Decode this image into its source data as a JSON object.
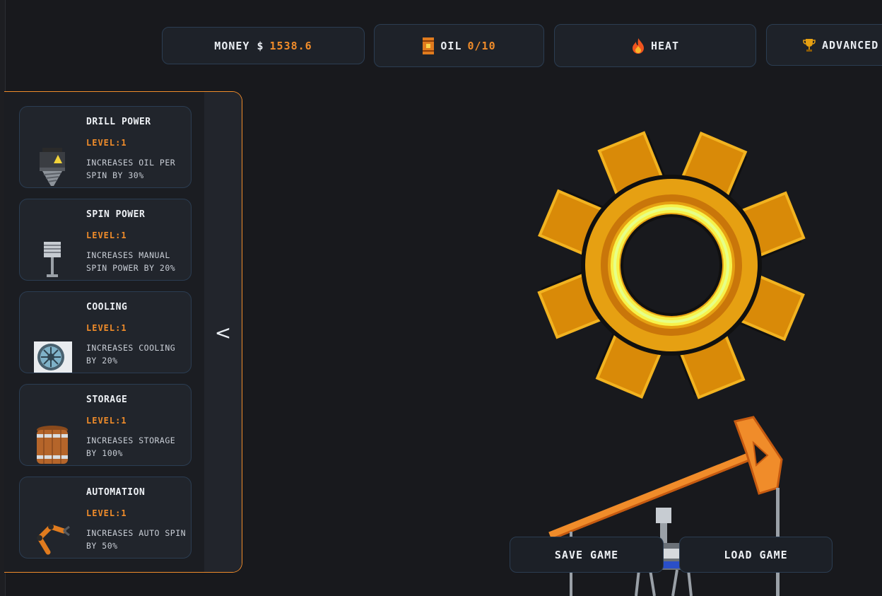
{
  "stats": {
    "money_label": "MONEY $",
    "money_value": "1538.6",
    "oil_label": "OIL",
    "oil_value": "0/10",
    "heat_label": "HEAT",
    "advanced_label": "ADVANCED"
  },
  "upgrades": [
    {
      "name": "DRILL POWER",
      "level": "LEVEL:1",
      "description": "INCREASES OIL PER SPIN BY 30%",
      "icon": "drill-icon"
    },
    {
      "name": "SPIN POWER",
      "level": "LEVEL:1",
      "description": "INCREASES MANUAL SPIN POWER BY 20%",
      "icon": "piston-icon"
    },
    {
      "name": "COOLING",
      "level": "LEVEL:1",
      "description": "INCREASES COOLING BY 20%",
      "icon": "fan-icon"
    },
    {
      "name": "STORAGE",
      "level": "LEVEL:1",
      "description": "INCREASES STORAGE BY 100%",
      "icon": "barrel-icon"
    },
    {
      "name": "AUTOMATION",
      "level": "LEVEL:1",
      "description": "INCREASES AUTO SPIN BY 50%",
      "icon": "robot-arm-icon"
    }
  ],
  "panel": {
    "collapse_label": "<"
  },
  "actions": {
    "save_label": "SAVE GAME",
    "load_label": "LOAD GAME"
  },
  "colors": {
    "accent": "#f08c2a",
    "background": "#18191d",
    "card": "#21252c",
    "border": "#2b3d52",
    "gear": "#e6a012"
  }
}
